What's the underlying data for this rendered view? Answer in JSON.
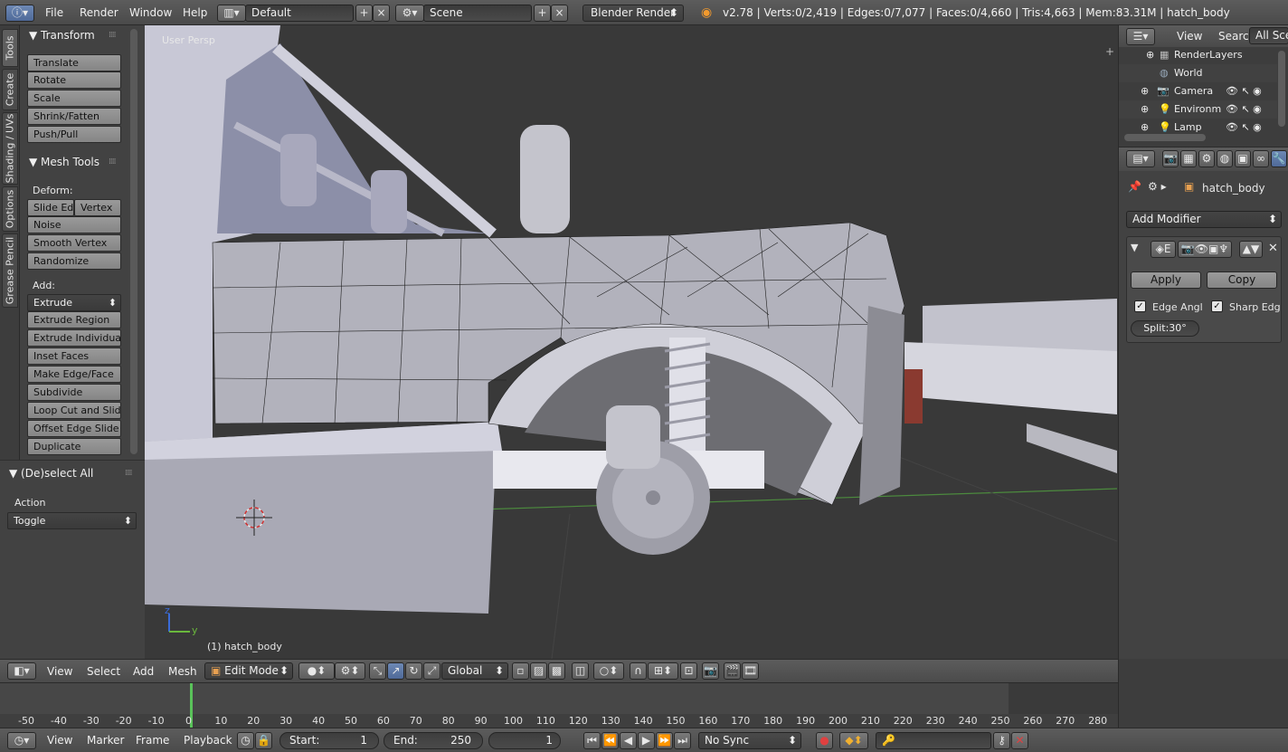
{
  "topbar": {
    "menus": [
      "File",
      "Render",
      "Window",
      "Help"
    ],
    "screen_layout": "Default",
    "scene": "Scene",
    "render_engine": "Blender Render",
    "stats": "v2.78 | Verts:0/2,419 | Edges:0/7,077 | Faces:0/4,660 | Tris:4,663 | Mem:83.31M | hatch_body"
  },
  "tabs": [
    "Tools",
    "Create",
    "Shading / UVs",
    "Options",
    "Grease Pencil"
  ],
  "toolshelf": {
    "transform": {
      "title": "Transform",
      "buttons": [
        "Translate",
        "Rotate",
        "Scale",
        "Shrink/Fatten",
        "Push/Pull"
      ]
    },
    "mesh_tools": {
      "title": "Mesh Tools",
      "deform_label": "Deform:",
      "slide_edge": "Slide Ed",
      "vertex": "Vertex",
      "deform_buttons": [
        "Noise",
        "Smooth Vertex",
        "Randomize"
      ],
      "add_label": "Add:",
      "extrude": "Extrude",
      "add_buttons": [
        "Extrude Region",
        "Extrude Individual",
        "Inset Faces",
        "Make Edge/Face",
        "Subdivide",
        "Loop Cut and Slide",
        "Offset Edge Slide",
        "Duplicate"
      ]
    }
  },
  "operator": {
    "title": "(De)select All",
    "action_label": "Action",
    "action_value": "Toggle"
  },
  "viewport": {
    "view_label": "User Persp",
    "object_label": "(1) hatch_body"
  },
  "outliner": {
    "menus": [
      "View",
      "Search"
    ],
    "filter": "All Scenes",
    "rows": [
      "RenderLayers",
      "World",
      "Camera",
      "Environment",
      "Lamp"
    ]
  },
  "properties": {
    "breadcrumb": "hatch_body",
    "add_modifier": "Add Modifier",
    "apply": "Apply",
    "copy": "Copy",
    "edge_angle": "Edge Angl",
    "sharp_edges": "Sharp Edg",
    "split": "Split:30°"
  },
  "vp_header": {
    "menus": [
      "View",
      "Select",
      "Add",
      "Mesh"
    ],
    "mode": "Edit Mode",
    "orientation": "Global"
  },
  "timeline": {
    "ticks": [
      "-50",
      "-40",
      "-30",
      "-20",
      "-10",
      "0",
      "10",
      "20",
      "30",
      "40",
      "50",
      "60",
      "70",
      "80",
      "90",
      "100",
      "110",
      "120",
      "130",
      "140",
      "150",
      "160",
      "170",
      "180",
      "190",
      "200",
      "210",
      "220",
      "230",
      "240",
      "250",
      "260",
      "270",
      "280"
    ],
    "current_frame_marker": 0
  },
  "tl_header": {
    "menus": [
      "View",
      "Marker",
      "Frame",
      "Playback"
    ],
    "start_label": "Start:",
    "start_value": "1",
    "end_label": "End:",
    "end_value": "250",
    "current_frame": "1",
    "sync": "No Sync"
  },
  "colors": {
    "accent": "#5680c2",
    "header": "#505050",
    "panel": "#424242"
  }
}
